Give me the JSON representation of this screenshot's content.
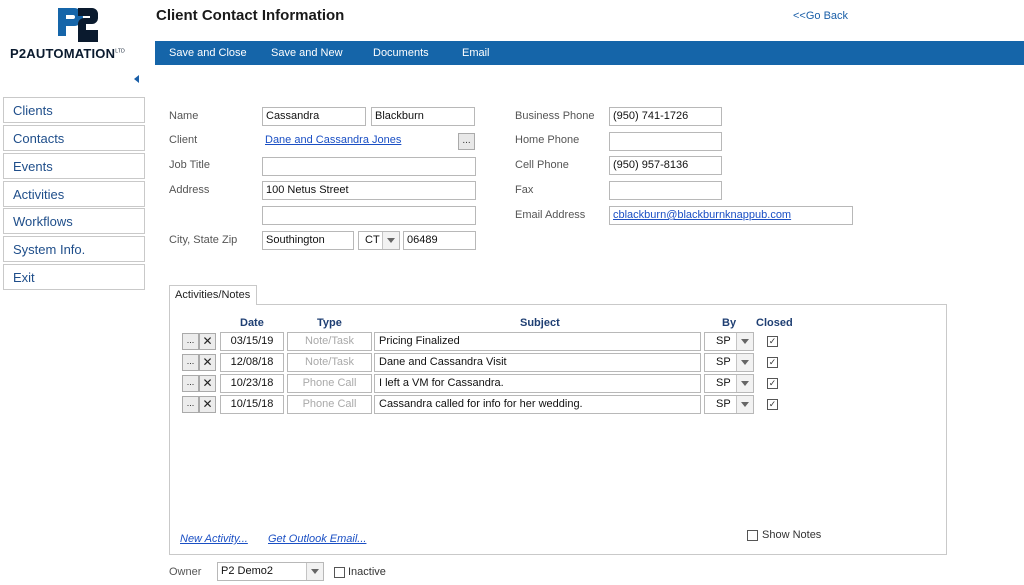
{
  "brand": {
    "name": "P2AUTOMATION",
    "suffix": "LTD",
    "mark": "P2"
  },
  "header": {
    "title": "Client Contact Information",
    "go_back": "<<Go Back"
  },
  "toolbar": {
    "save_close": "Save and Close",
    "save_new": "Save and New",
    "documents": "Documents",
    "email": "Email"
  },
  "sidebar": {
    "items": [
      "Clients",
      "Contacts",
      "Events",
      "Activities",
      "Workflows",
      "System Info.",
      "Exit"
    ]
  },
  "form": {
    "labels": {
      "name": "Name",
      "client": "Client",
      "job_title": "Job Title",
      "address": "Address",
      "city_state_zip": "City, State Zip",
      "business_phone": "Business Phone",
      "home_phone": "Home Phone",
      "cell_phone": "Cell Phone",
      "fax": "Fax",
      "email_address": "Email Address"
    },
    "values": {
      "first_name": "Cassandra",
      "last_name": "Blackburn",
      "client": "Dane and Cassandra Jones",
      "job_title": "",
      "address1": "100 Netus Street",
      "address2": "",
      "city": "Southington",
      "state": "CT",
      "zip": "06489",
      "business_phone": "(950) 741-1726",
      "home_phone": "",
      "cell_phone": "(950) 957-8136",
      "fax": "",
      "email": "cblackburn@blackburnknappub.com"
    },
    "ellipsis": "..."
  },
  "activities": {
    "tab_label": "Activities/Notes",
    "columns": {
      "date": "Date",
      "type": "Type",
      "subject": "Subject",
      "by": "By",
      "closed": "Closed"
    },
    "rows": [
      {
        "date": "03/15/19",
        "type": "Note/Task",
        "subject": "Pricing Finalized",
        "by": "SP",
        "closed": true
      },
      {
        "date": "12/08/18",
        "type": "Note/Task",
        "subject": "Dane and Cassandra Visit",
        "by": "SP",
        "closed": true
      },
      {
        "date": "10/23/18",
        "type": "Phone Call",
        "subject": "I left a VM for Cassandra.",
        "by": "SP",
        "closed": true
      },
      {
        "date": "10/15/18",
        "type": "Phone Call",
        "subject": "Cassandra called for info for her wedding.",
        "by": "SP",
        "closed": true
      }
    ],
    "row_open": "...",
    "row_delete": "✕",
    "check_mark": "✓",
    "new_activity": "New Activity...",
    "get_outlook": "Get Outlook Email...",
    "show_notes": "Show Notes",
    "show_notes_checked": false
  },
  "footer": {
    "owner_label": "Owner",
    "owner_value": "P2 Demo2",
    "inactive_label": "Inactive",
    "inactive_checked": false
  },
  "colors": {
    "accent": "#1565a9",
    "link": "#1a4fc4",
    "header_text": "#1f3f73"
  }
}
